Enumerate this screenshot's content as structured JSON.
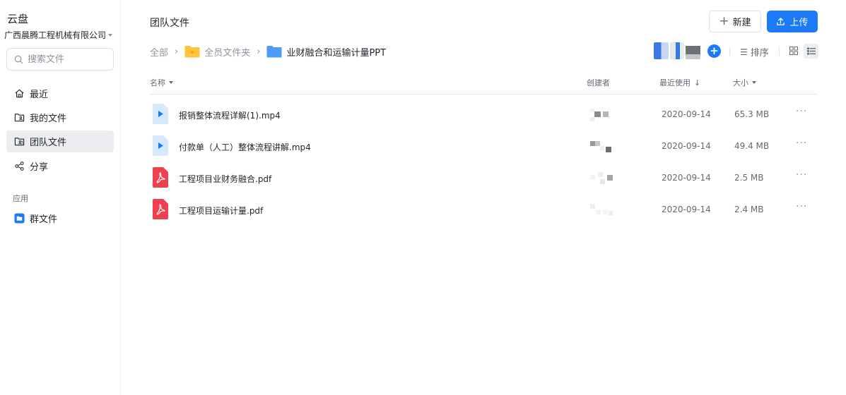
{
  "app": {
    "title": "云盘",
    "org_name": "广西晨腾工程机械有限公司"
  },
  "search": {
    "placeholder": "搜索文件"
  },
  "nav": {
    "items": [
      {
        "label": "最近",
        "icon": "home-icon"
      },
      {
        "label": "我的文件",
        "icon": "my-files-icon"
      },
      {
        "label": "团队文件",
        "icon": "team-files-icon",
        "active": true
      },
      {
        "label": "分享",
        "icon": "share-icon"
      }
    ],
    "apps_section_label": "应用",
    "apps": [
      {
        "label": "群文件",
        "icon": "group-files-icon"
      }
    ]
  },
  "header": {
    "title": "团队文件",
    "new_label": "新建",
    "upload_label": "上传"
  },
  "breadcrumb": [
    {
      "label": "全部"
    },
    {
      "label": "全员文件夹"
    },
    {
      "label": "业财融合和运输计量PPT"
    }
  ],
  "toolbar": {
    "sort_label": "排序"
  },
  "table": {
    "columns": {
      "name": "名称",
      "creator": "创建者",
      "recent": "最近使用",
      "size": "大小"
    },
    "rows": [
      {
        "name": "报销整体流程详解(1).mp4",
        "type": "video",
        "date": "2020-09-14",
        "size": "65.3 MB"
      },
      {
        "name": "付款单（人工）整体流程讲解.mp4",
        "type": "video",
        "date": "2020-09-14",
        "size": "49.4 MB"
      },
      {
        "name": "工程项目业财务融合.pdf",
        "type": "pdf",
        "date": "2020-09-14",
        "size": "2.5 MB"
      },
      {
        "name": "工程项目运输计量.pdf",
        "type": "pdf",
        "date": "2020-09-14",
        "size": "2.4 MB"
      }
    ]
  },
  "colors": {
    "accent": "#1a7af8",
    "pdf": "#f04050",
    "video_bg": "#d5e8fd",
    "folder": "#ffc53d",
    "folder_blue": "#4d9cf8"
  }
}
